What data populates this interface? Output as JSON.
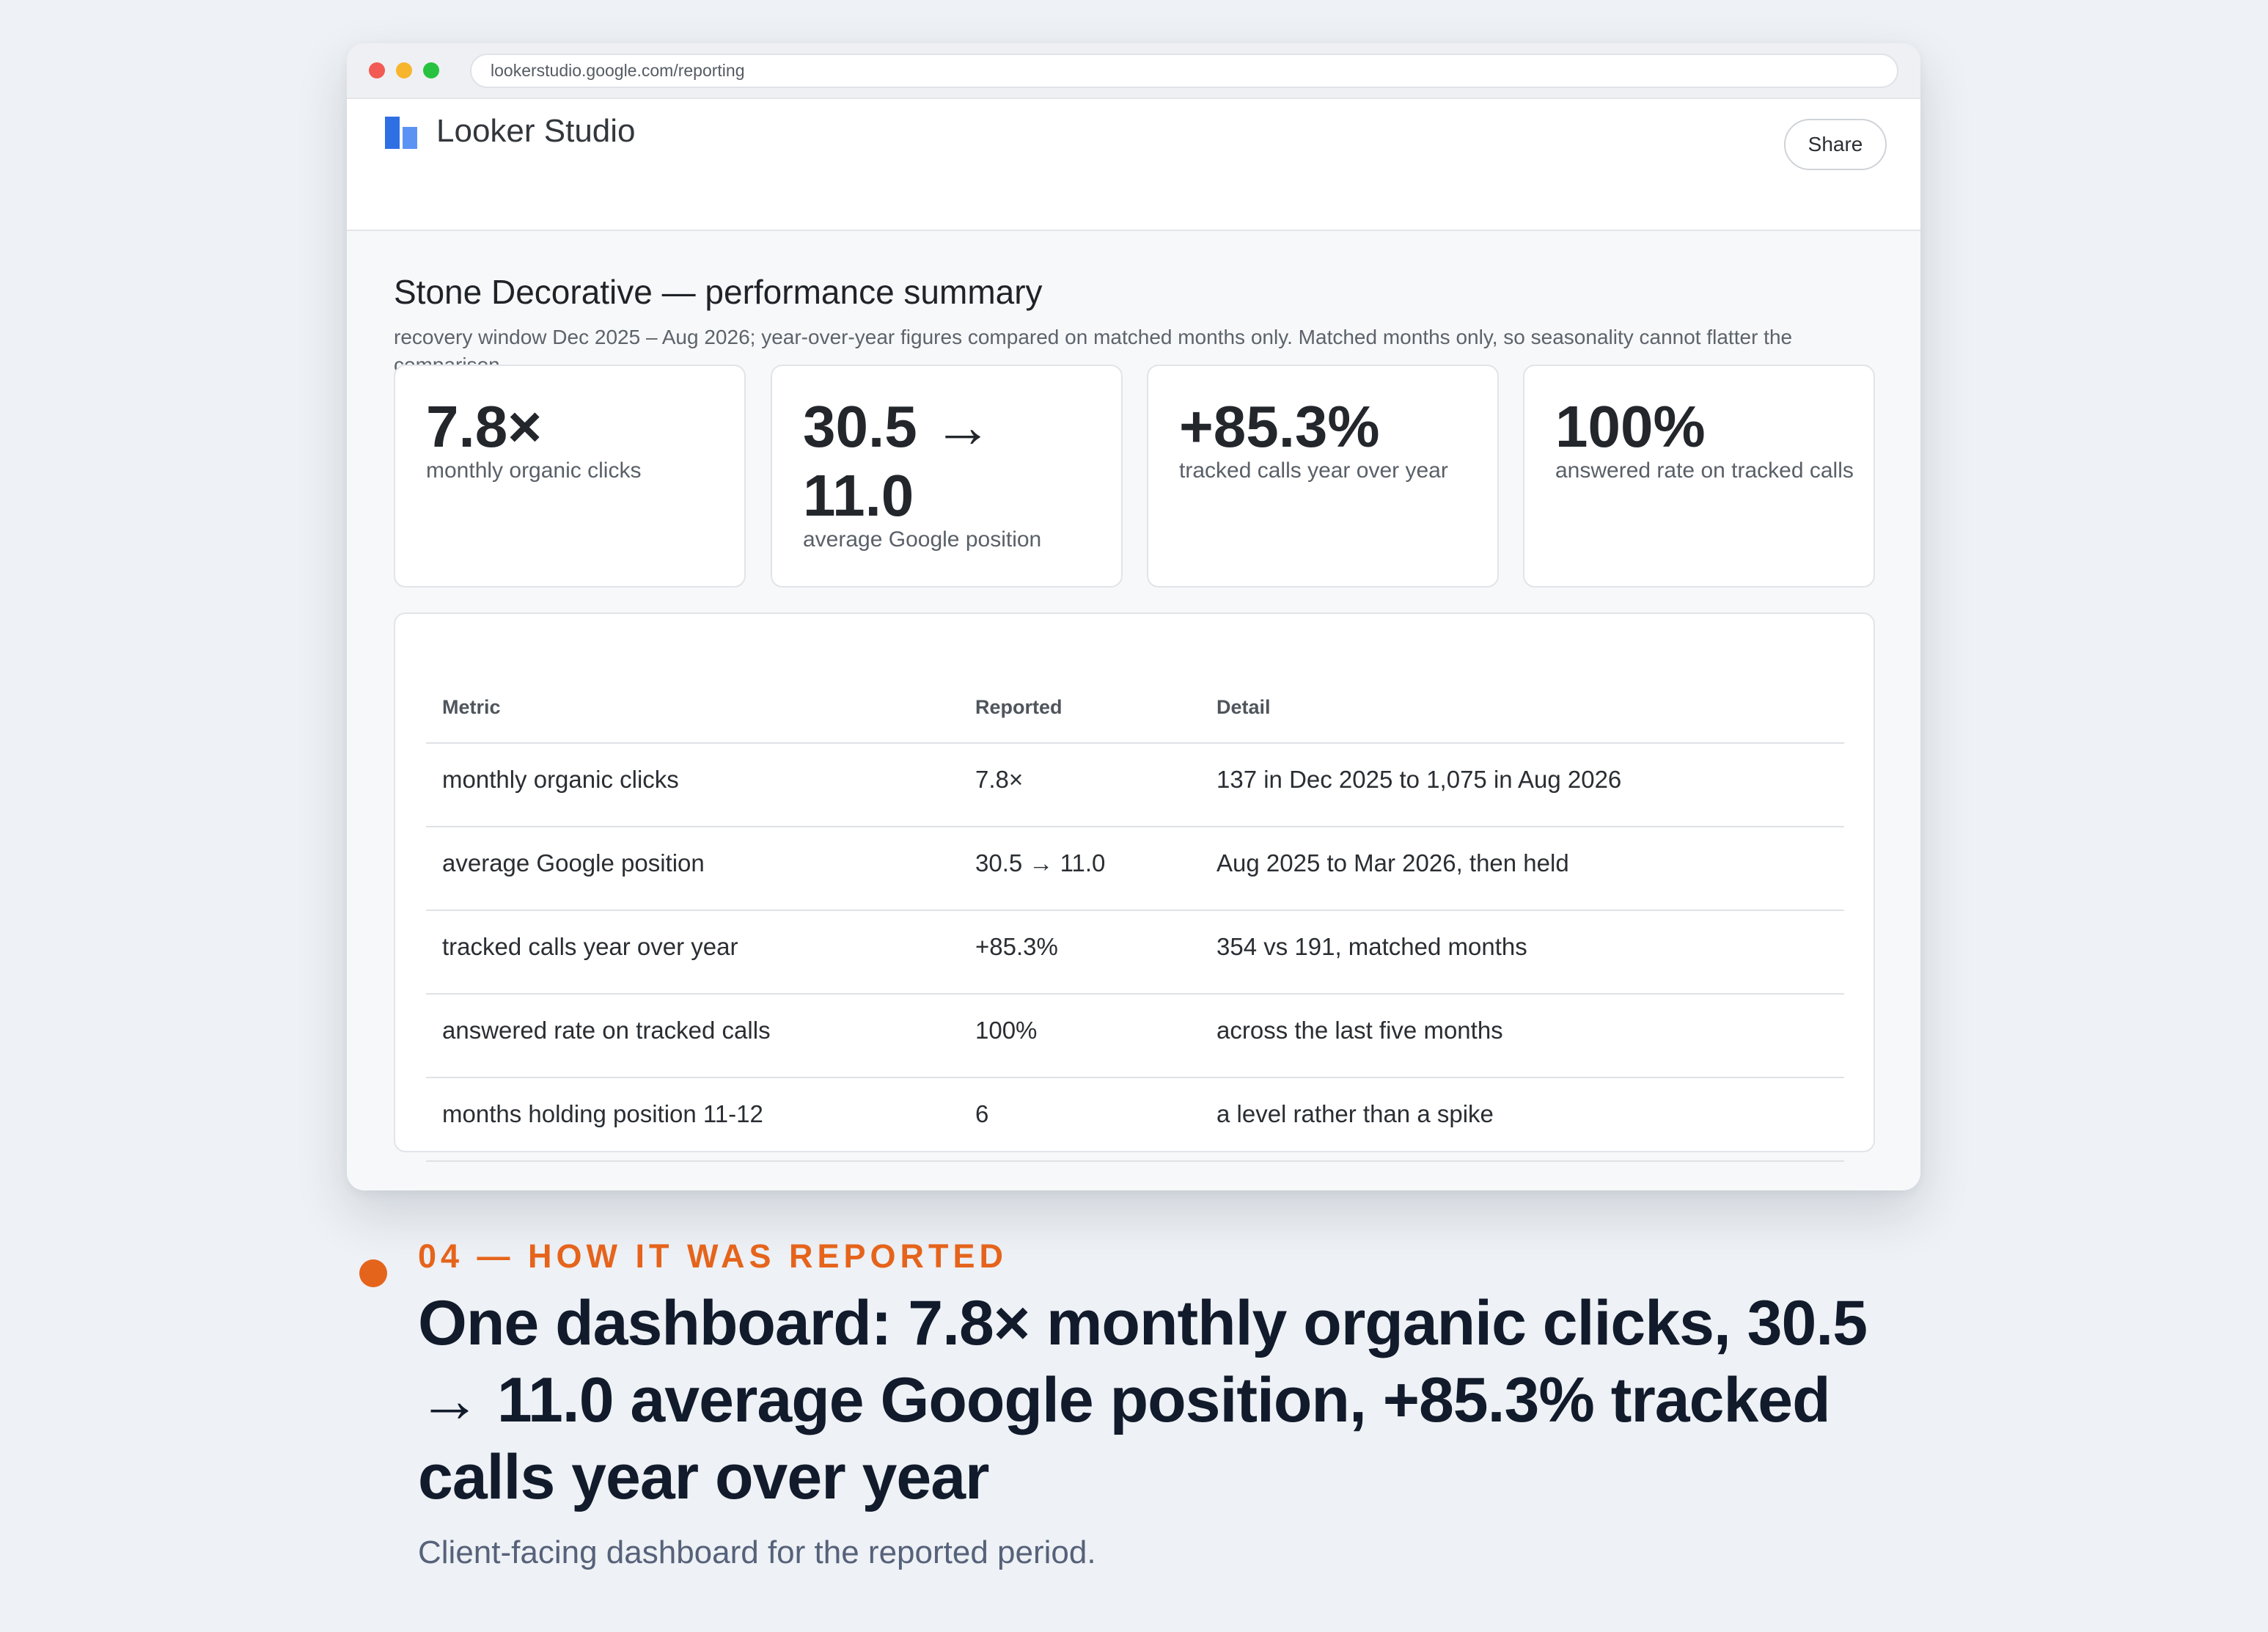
{
  "browser": {
    "url": "lookerstudio.google.com/reporting"
  },
  "app": {
    "name": "Looker Studio",
    "share_label": "Share"
  },
  "report": {
    "title": "Stone Decorative — performance summary",
    "subtitle": "recovery window Dec 2025 – Aug 2026; year-over-year figures compared on matched months only. Matched months only, so seasonality cannot flatter the comparison."
  },
  "kpis": [
    {
      "value": "7.8×",
      "label": "monthly organic clicks"
    },
    {
      "value": "30.5 → 11.0",
      "label": "average Google position"
    },
    {
      "value": "+85.3%",
      "label": "tracked calls year over year"
    },
    {
      "value": "100%",
      "label": "answered rate on tracked calls"
    }
  ],
  "table": {
    "headers": [
      "Metric",
      "Reported",
      "Detail"
    ],
    "rows": [
      {
        "metric": "monthly organic clicks",
        "reported": "7.8×",
        "detail": "137 in Dec 2025 to 1,075 in Aug 2026"
      },
      {
        "metric": "average Google position",
        "reported": "30.5 → 11.0",
        "detail": "Aug 2025 to Mar 2026, then held"
      },
      {
        "metric": "tracked calls year over year",
        "reported": "+85.3%",
        "detail": "354 vs 191, matched months"
      },
      {
        "metric": "answered rate on tracked calls",
        "reported": "100%",
        "detail": "across the last five months"
      },
      {
        "metric": "months holding position 11-12",
        "reported": "6",
        "detail": "a level rather than a spike"
      }
    ]
  },
  "slide": {
    "eyebrow": "04 — HOW IT WAS REPORTED",
    "headline": "One dashboard: 7.8× monthly organic clicks, 30.5 → 11.0 average Google position, +85.3% tracked calls year over year",
    "caption": "Client-facing dashboard for the reported period."
  },
  "colors": {
    "accent": "#e5641c",
    "logo_dark": "#2f6fe4",
    "logo_light": "#5b93f5",
    "headline": "#111b2b"
  }
}
